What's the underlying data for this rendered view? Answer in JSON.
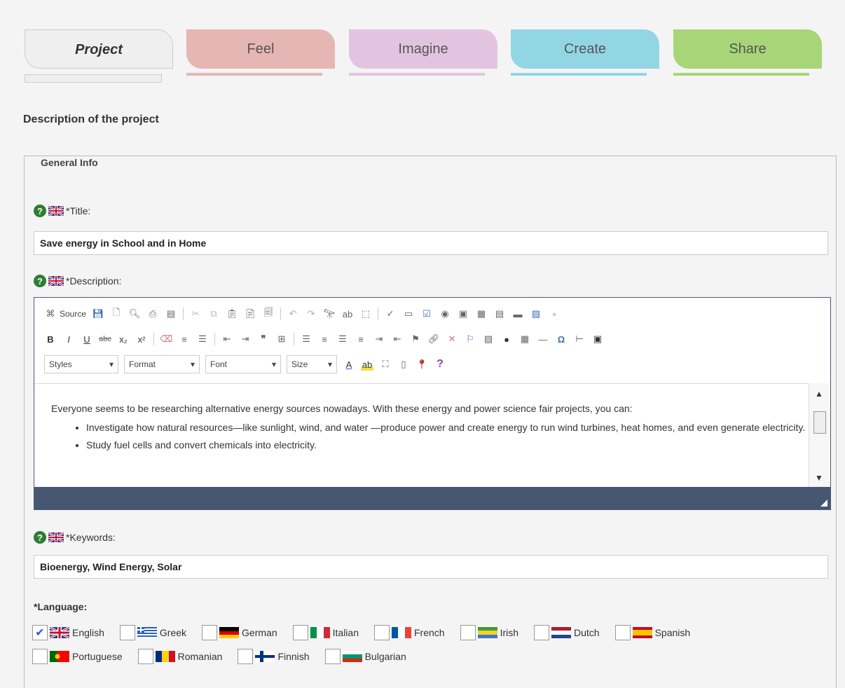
{
  "tabs": [
    {
      "label": "Project",
      "color": "#efefef"
    },
    {
      "label": "Feel",
      "color": "#e6b6b4"
    },
    {
      "label": "Imagine",
      "color": "#e3c4e0"
    },
    {
      "label": "Create",
      "color": "#92d6e4"
    },
    {
      "label": "Share",
      "color": "#a8d578"
    }
  ],
  "section_title": "Description of the project",
  "general_info": {
    "legend": "General Info",
    "title_label": "*Title:",
    "title_value": "Save energy in School and in Home",
    "description_label": "*Description:",
    "keywords_label": "*Keywords:",
    "keywords_value": "Bioenergy, Wind Energy, Solar"
  },
  "editor": {
    "source_label": "Source",
    "styles_label": "Styles",
    "format_label": "Format",
    "font_label": "Font",
    "size_label": "Size",
    "content_paragraph": "Everyone seems to be researching alternative energy sources nowadays. With these energy and power science fair projects, you can:",
    "content_items": [
      "Investigate how natural resources—like sunlight, wind, and water —produce power and create energy to run wind turbines, heat homes, and even generate electricity.",
      "Study fuel cells and convert chemicals into electricity."
    ]
  },
  "language": {
    "label": "*Language:",
    "options": [
      {
        "name": "English",
        "checked": true
      },
      {
        "name": "Greek",
        "checked": false
      },
      {
        "name": "German",
        "checked": false
      },
      {
        "name": "Italian",
        "checked": false
      },
      {
        "name": "French",
        "checked": false
      },
      {
        "name": "Irish",
        "checked": false
      },
      {
        "name": "Dutch",
        "checked": false
      },
      {
        "name": "Spanish",
        "checked": false
      },
      {
        "name": "Portuguese",
        "checked": false
      },
      {
        "name": "Romanian",
        "checked": false
      },
      {
        "name": "Finnish",
        "checked": false
      },
      {
        "name": "Bulgarian",
        "checked": false
      }
    ]
  }
}
